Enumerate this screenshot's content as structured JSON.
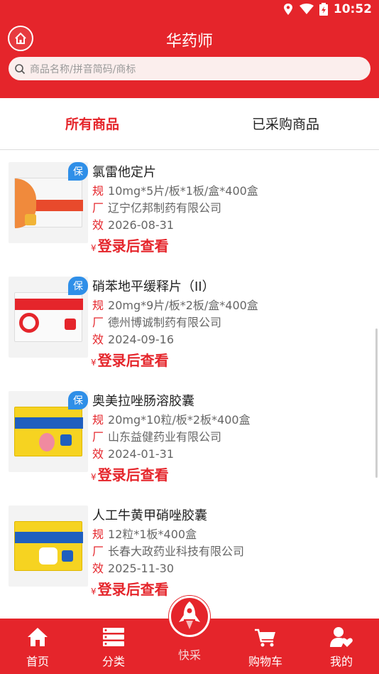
{
  "status_bar": {
    "time": "10:52"
  },
  "header": {
    "title": "华药师",
    "search_placeholder": "商品名称/拼音简码/商标"
  },
  "tabs": [
    {
      "label": "所有商品",
      "active": true
    },
    {
      "label": "已采购商品",
      "active": false
    }
  ],
  "colors": {
    "brand_red": "#e5252b",
    "insured_badge": "#2f8fe8"
  },
  "products": [
    {
      "name": "氯雷他定片",
      "insured_badge": "保",
      "spec_tag": "规",
      "spec": "10mg*5片/板*1板/盒*400盒",
      "maker_tag": "厂",
      "maker": "辽宁亿邦制药有限公司",
      "expiry_tag": "效",
      "expiry": "2026-08-31",
      "price_symbol": "¥",
      "price_text": "登录后查看"
    },
    {
      "name": "硝苯地平缓释片（II）",
      "insured_badge": "保",
      "spec_tag": "规",
      "spec": "20mg*9片/板*2板/盒*400盒",
      "maker_tag": "厂",
      "maker": "德州博诚制药有限公司",
      "expiry_tag": "效",
      "expiry": "2024-09-16",
      "price_symbol": "¥",
      "price_text": "登录后查看"
    },
    {
      "name": "奥美拉唑肠溶胶囊",
      "insured_badge": "保",
      "spec_tag": "规",
      "spec": "20mg*10粒/板*2板*400盒",
      "maker_tag": "厂",
      "maker": "山东益健药业有限公司",
      "expiry_tag": "效",
      "expiry": "2024-01-31",
      "price_symbol": "¥",
      "price_text": "登录后查看"
    },
    {
      "name": "人工牛黄甲硝唑胶囊",
      "insured_badge": "",
      "spec_tag": "规",
      "spec": "12粒*1板*400盒",
      "maker_tag": "厂",
      "maker": "长春大政药业科技有限公司",
      "expiry_tag": "效",
      "expiry": "2025-11-30",
      "price_symbol": "¥",
      "price_text": "登录后查看"
    }
  ],
  "bottom_nav": [
    {
      "label": "首页",
      "icon": "home-icon"
    },
    {
      "label": "分类",
      "icon": "category-list-icon"
    },
    {
      "label": "快采",
      "icon": "rocket-icon"
    },
    {
      "label": "购物车",
      "icon": "cart-icon"
    },
    {
      "label": "我的",
      "icon": "user-heart-icon"
    }
  ]
}
